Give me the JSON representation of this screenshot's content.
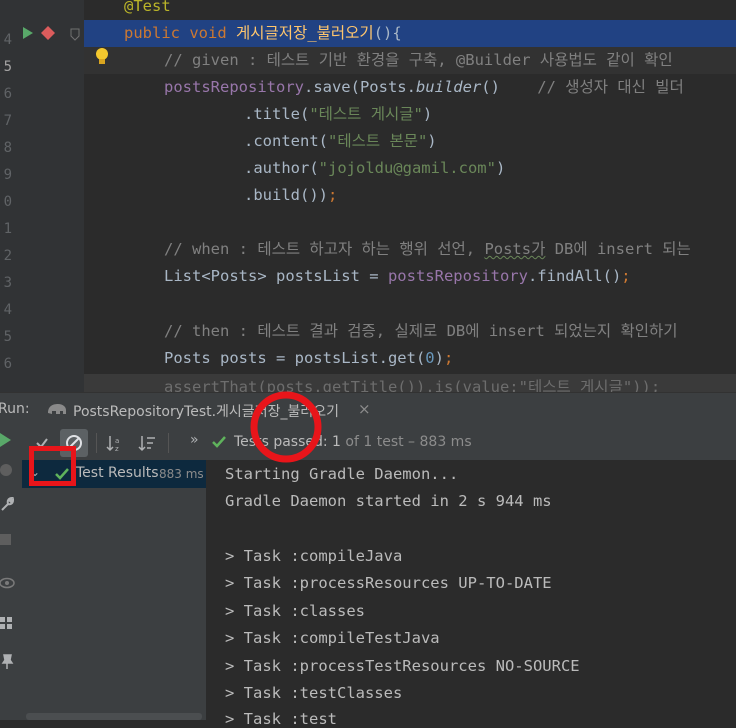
{
  "editor": {
    "gutter_numbers": [
      "4",
      "5",
      "6",
      "7",
      "8",
      "9",
      "0",
      "1",
      "2",
      "3",
      "4",
      "5",
      "6"
    ],
    "lines": [
      {
        "kind": "annotation",
        "text": "@Test"
      },
      {
        "kind": "method",
        "k1": "public",
        "k2": "void",
        "name": "게시글저장_불러오기",
        "rest": "(){"
      },
      {
        "kind": "comment",
        "text": "// given : 테스트 기반 환경을 구축, @Builder 사용법도 같이 확인"
      },
      {
        "kind": "save",
        "field": "postsRepository",
        "a": ".save(Posts.",
        "b": "builder",
        "c": "()",
        "comment": "// 생성자 대신 빌더"
      },
      {
        "kind": "call",
        "method": ".title(",
        "arg": "\"테스트 게시글\"",
        "close": ")"
      },
      {
        "kind": "call",
        "method": ".content(",
        "arg": "\"테스트 본문\"",
        "close": ")"
      },
      {
        "kind": "call",
        "method": ".author(",
        "arg": "\"jojoldu@gamil.com\"",
        "close": ")"
      },
      {
        "kind": "build",
        "text": ".build())",
        "semi": ";"
      },
      {
        "kind": "blank"
      },
      {
        "kind": "comment2",
        "pre": "// when : 테스트 하고자 하는 행위 선언, ",
        "u": "Posts가",
        "post": " DB에 insert 되는"
      },
      {
        "kind": "list",
        "a": "List<Posts> postsList = ",
        "field": "postsRepository",
        "b": ".findAll()",
        "semi": ";"
      },
      {
        "kind": "blank"
      },
      {
        "kind": "comment",
        "text": "// then : 테스트 결과 검증, 실제로 DB에 insert 되었는지 확인하기"
      },
      {
        "kind": "posts",
        "a": "Posts posts = postsList.get(",
        "num": "0",
        "b": ")",
        "semi": ";"
      },
      {
        "kind": "partial",
        "text": "assertThat(posts.getTitle()).is(value:\"테스트 게시글\"));"
      }
    ]
  },
  "run": {
    "label": "Run:",
    "tab_title": "PostsRepositoryTest.게시글저장_불러오기",
    "tab_close": "×",
    "status_text": "Tests passed:",
    "status_count": "1",
    "status_rest": "of 1 test – 883 ms",
    "tree_label": "Test Results",
    "tree_time": "883 ms",
    "console_lines": [
      "Starting Gradle Daemon...",
      "Gradle Daemon started in 2 s 944 ms",
      "",
      "> Task :compileJava",
      "> Task :processResources UP-TO-DATE",
      "> Task :classes",
      "> Task :compileTestJava",
      "> Task :processTestResources NO-SOURCE",
      "> Task :testClasses",
      "> Task :test"
    ]
  },
  "colors": {
    "highlight": "#214283",
    "annotation_red": "#e8151a",
    "pass_green": "#5fb35c",
    "run_green": "#59a869"
  }
}
